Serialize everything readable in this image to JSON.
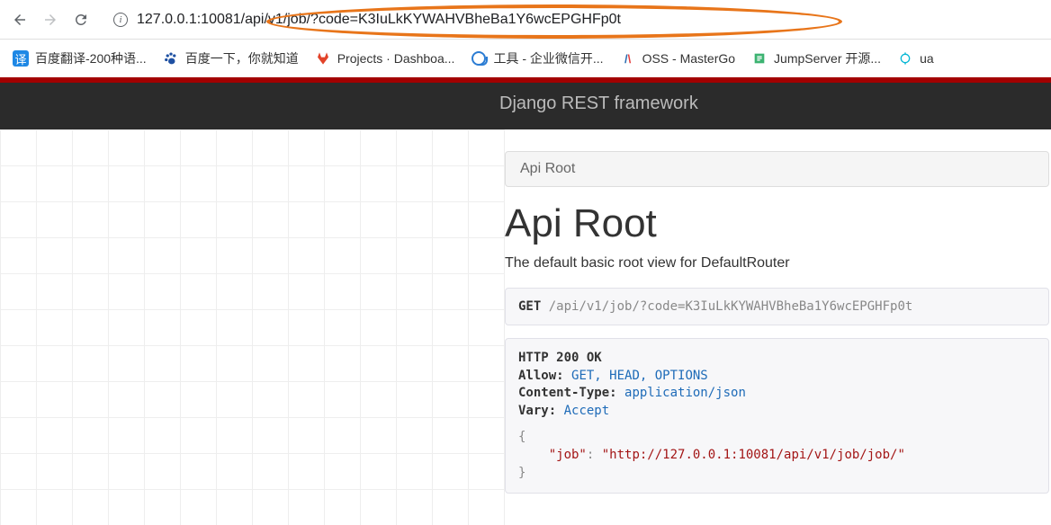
{
  "url": "127.0.0.1:10081/api/v1/job/?code=K3IuLkKYWAHVBheBa1Y6wcEPGHFp0t",
  "bookmarks": [
    {
      "label": "百度翻译-200种语..."
    },
    {
      "label": "百度一下，你就知道"
    },
    {
      "label": "Projects · Dashboa..."
    },
    {
      "label": "工具 - 企业微信开..."
    },
    {
      "label": "OSS - MasterGo"
    },
    {
      "label": "JumpServer 开源..."
    },
    {
      "label": "ua"
    }
  ],
  "drf_brand": "Django REST framework",
  "breadcrumb": "Api Root",
  "page_title": "Api Root",
  "page_desc": "The default basic root view for DefaultRouter",
  "request": {
    "method": "GET",
    "path": "/api/v1/job/?code=K3IuLkKYWAHVBheBa1Y6wcEPGHFp0t"
  },
  "response": {
    "status_line": "HTTP 200 OK",
    "allow_label": "Allow:",
    "allow_value": "GET, HEAD, OPTIONS",
    "ctype_label": "Content-Type:",
    "ctype_value": "application/json",
    "vary_label": "Vary:",
    "vary_value": "Accept",
    "body_key": "\"job\"",
    "body_val": "\"http://127.0.0.1:10081/api/v1/job/job/\""
  }
}
